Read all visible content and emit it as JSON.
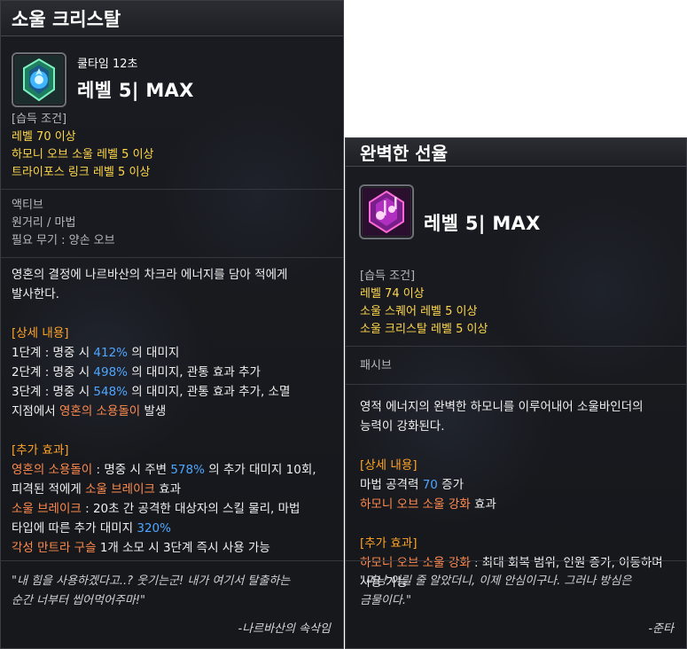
{
  "left": {
    "title": "소울 크리스탈",
    "cooldown": "쿨타임 12초",
    "level": "레벨 5| MAX",
    "acquire_header": "[습득 조건]",
    "requirements": [
      "레벨 70 이상",
      "하모니 오브 소울 레벨 5 이상",
      "트라이포스 링크 레벨 5 이상"
    ],
    "type": "액티브",
    "range": "원거리 / 마법",
    "weapon": "필요 무기 : 양손 오브",
    "desc_line1": "영혼의 결정에 나르바산의 차크라 에너지를 담아 적에게",
    "desc_line2": "발사한다.",
    "detail_header": "[상세 내용]",
    "stage1_prefix": "1단계 : 명중 시 ",
    "stage1_value": "412%",
    "stage1_suffix": " 의 대미지",
    "stage2_prefix": "2단계 : 명중 시 ",
    "stage2_value": "498%",
    "stage2_suffix": " 의 대미지, 관통 효과 추가",
    "stage3_prefix": "3단계 : 명중 시 ",
    "stage3_value": "548%",
    "stage3_suffix": " 의 대미지, 관통 효과 추가, 소멸",
    "stage3b_prefix": "지점에서 ",
    "stage3b_highlight": "영혼의 소용돌이",
    "stage3b_suffix": " 발생",
    "extra_header": "[추가 효과]",
    "ex1_name": "영혼의 소용돌이",
    "ex1_mid": " : 명중 시 주변 ",
    "ex1_value": "578%",
    "ex1_suffix": " 의 추가 대미지 10회,",
    "ex2_prefix": "피격된 적에게 ",
    "ex2_name": "소울 브레이크",
    "ex2_suffix": " 효과",
    "ex3_name": "소울 브레이크",
    "ex3_suffix": " : 20초 간 공격한 대상자의 스킬 물리, 마법",
    "ex4_prefix": "타입에 따른 추가 대미지 ",
    "ex4_value": "320%",
    "ex5_name": "각성 만트라 구슬",
    "ex5_suffix": " 1개 소모 시 3단계 즉시 사용 가능",
    "quote_line1": "\"내 힘을 사용하겠다고..? 웃기는군! 내가 여기서 탈출하는",
    "quote_line2": "순간 너부터 씹어먹어주마!\"",
    "quote_author": "-나르바산의 속삭임"
  },
  "right": {
    "title": "완벽한 선율",
    "level": "레벨 5| MAX",
    "acquire_header": "[습득 조건]",
    "requirements": [
      "레벨 74 이상",
      "소울 스퀘어 레벨 5 이상",
      "소울 크리스탈 레벨 5 이상"
    ],
    "type": "패시브",
    "desc_line1": "영적 에너지의 완벽한 하모니를 이루어내어 소울바인더의",
    "desc_line2": "능력이 강화된다.",
    "detail_header": "[상세 내용]",
    "d1_prefix": "마법 공격력 ",
    "d1_value": "70",
    "d1_suffix": " 증가",
    "d2_name": "하모니 오브 소울 강화",
    "d2_suffix": " 효과",
    "extra_header": "[추가 효과]",
    "ex1_name": "하모니 오브 소울 강화",
    "ex1_suffix": " : 최대 회복 범위, 인원 증가, 이동하며",
    "ex2": "사용 가능",
    "quote_line1": "\"마냥 어릴 줄 알았더니, 이제 안심이구나. 그러나 방심은",
    "quote_line2": "금물이다.\"",
    "quote_author": "-준타"
  },
  "icons": {
    "left_skill": "soul-crystal-icon",
    "right_skill": "perfect-melody-icon"
  },
  "colors": {
    "requirement": "#ffd74a",
    "section_header": "#ffa326",
    "value": "#4ea6ff",
    "keyword": "#ff8a4e"
  }
}
